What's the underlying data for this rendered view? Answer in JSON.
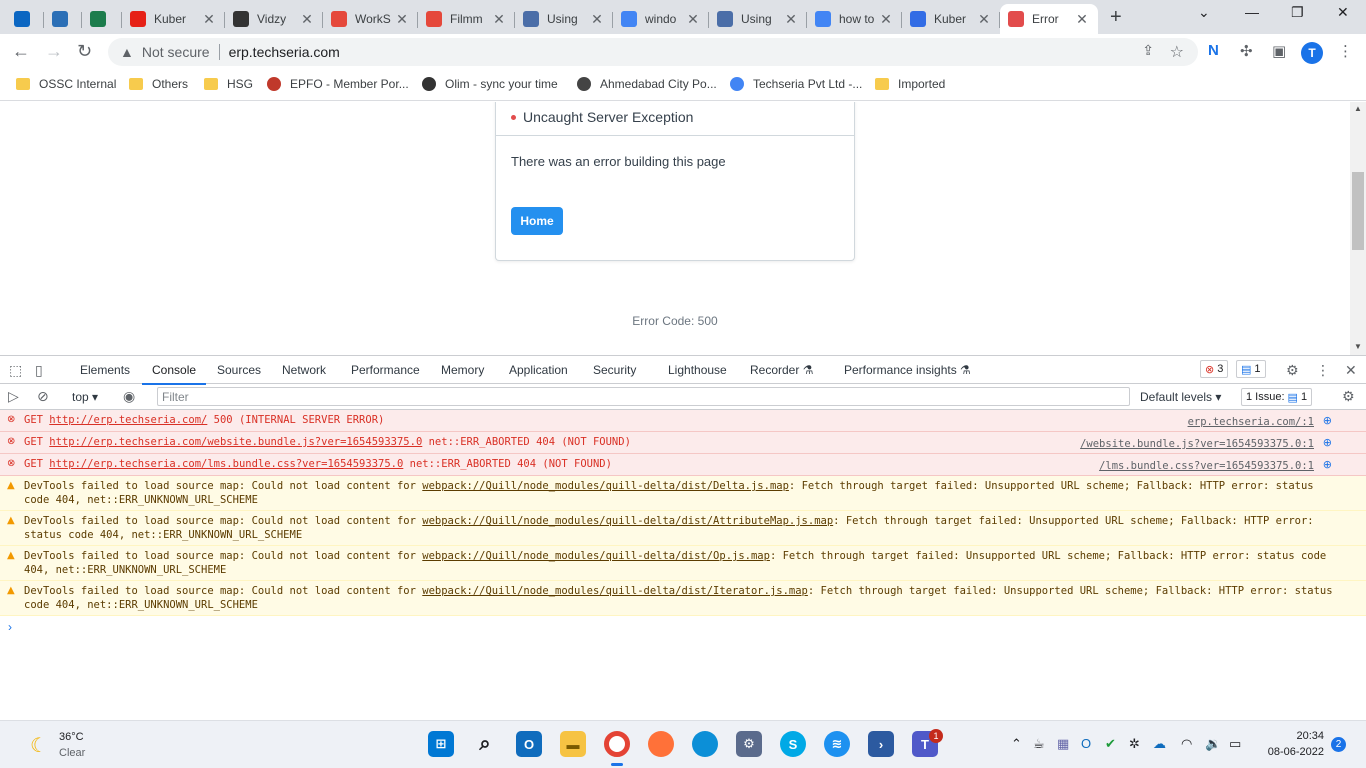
{
  "browser": {
    "tabs": [
      {
        "title": "",
        "color": "#0b66c2"
      },
      {
        "title": "",
        "color": "#2b6fb6"
      },
      {
        "title": "",
        "color": "#1c7c4c"
      },
      {
        "title": "Kuber",
        "color": "#e62117"
      },
      {
        "title": "Vidzy",
        "color": "#333333"
      },
      {
        "title": "WorkS",
        "color": "#e5483b"
      },
      {
        "title": "Filmm",
        "color": "#e5483b"
      },
      {
        "title": "Using",
        "color": "#4b6ea8"
      },
      {
        "title": "windo",
        "color": "#4285f4"
      },
      {
        "title": "Using",
        "color": "#4b6ea8"
      },
      {
        "title": "how to",
        "color": "#4285f4"
      },
      {
        "title": "Kuber",
        "color": "#326ce5"
      },
      {
        "title": "Error",
        "color": "#e24c4c",
        "active": true
      }
    ],
    "new_tab": "+",
    "omnibox": {
      "security": "Not secure",
      "url": "erp.techseria.com"
    },
    "profile_initial": "T",
    "bookmarks": [
      {
        "label": "OSSC Internal",
        "type": "folder"
      },
      {
        "label": "Others",
        "type": "folder"
      },
      {
        "label": "HSG",
        "type": "folder"
      },
      {
        "label": "EPFO - Member Por...",
        "type": "site",
        "color": "#c0392b"
      },
      {
        "label": "Olim - sync your time",
        "type": "site",
        "color": "#333333"
      },
      {
        "label": "Ahmedabad City Po...",
        "type": "site",
        "color": "#444444"
      },
      {
        "label": "Techseria Pvt Ltd -...",
        "type": "site",
        "color": "#4285f4"
      },
      {
        "label": "Imported",
        "type": "folder"
      }
    ]
  },
  "page": {
    "error_title": "Uncaught Server Exception",
    "message": "There was an error building this page",
    "home_button": "Home",
    "error_code": "Error Code: 500"
  },
  "devtools": {
    "tabs": [
      "Elements",
      "Console",
      "Sources",
      "Network",
      "Performance",
      "Memory",
      "Application",
      "Security",
      "Lighthouse",
      "Recorder",
      "Performance insights"
    ],
    "active_tab": "Console",
    "error_count": "3",
    "message_count": "1",
    "context": "top",
    "filter_placeholder": "Filter",
    "levels": "Default levels",
    "issues": "1 Issue:",
    "issues_count": "1",
    "messages": [
      {
        "level": "error",
        "prefix": "GET ",
        "link": "http://erp.techseria.com/",
        "suffix": " 500 (INTERNAL SERVER ERROR)",
        "source": "erp.techseria.com/:1"
      },
      {
        "level": "error",
        "prefix": "GET ",
        "link": "http://erp.techseria.com/website.bundle.js?ver=1654593375.0",
        "suffix": " net::ERR_ABORTED 404 (NOT FOUND)",
        "source": "/website.bundle.js?ver=1654593375.0:1"
      },
      {
        "level": "error",
        "prefix": "GET ",
        "link": "http://erp.techseria.com/lms.bundle.css?ver=1654593375.0",
        "suffix": " net::ERR_ABORTED 404 (NOT FOUND)",
        "source": "/lms.bundle.css?ver=1654593375.0:1"
      },
      {
        "level": "warn",
        "prefix": "DevTools failed to load source map: Could not load content for ",
        "link": "webpack://Quill/node_modules/quill-delta/dist/Delta.js.map",
        "suffix": ": Fetch through target failed: Unsupported URL scheme; Fallback: HTTP error: status code 404, net::ERR_UNKNOWN_URL_SCHEME"
      },
      {
        "level": "warn",
        "prefix": "DevTools failed to load source map: Could not load content for ",
        "link": "webpack://Quill/node_modules/quill-delta/dist/AttributeMap.js.map",
        "suffix": ": Fetch through target failed: Unsupported URL scheme; Fallback: HTTP error: status code 404, net::ERR_UNKNOWN_URL_SCHEME"
      },
      {
        "level": "warn",
        "prefix": "DevTools failed to load source map: Could not load content for ",
        "link": "webpack://Quill/node_modules/quill-delta/dist/Op.js.map",
        "suffix": ": Fetch through target failed: Unsupported URL scheme; Fallback: HTTP error: status code 404, net::ERR_UNKNOWN_URL_SCHEME"
      },
      {
        "level": "warn",
        "prefix": "DevTools failed to load source map: Could not load content for ",
        "link": "webpack://Quill/node_modules/quill-delta/dist/Iterator.js.map",
        "suffix": ": Fetch through target failed: Unsupported URL scheme; Fallback: HTTP error: status code 404, net::ERR_UNKNOWN_URL_SCHEME"
      }
    ]
  },
  "taskbar": {
    "weather_temp": "36°C",
    "weather_desc": "Clear",
    "time": "20:34",
    "date": "08-06-2022",
    "notification_count": "2",
    "teams_badge": "1"
  }
}
